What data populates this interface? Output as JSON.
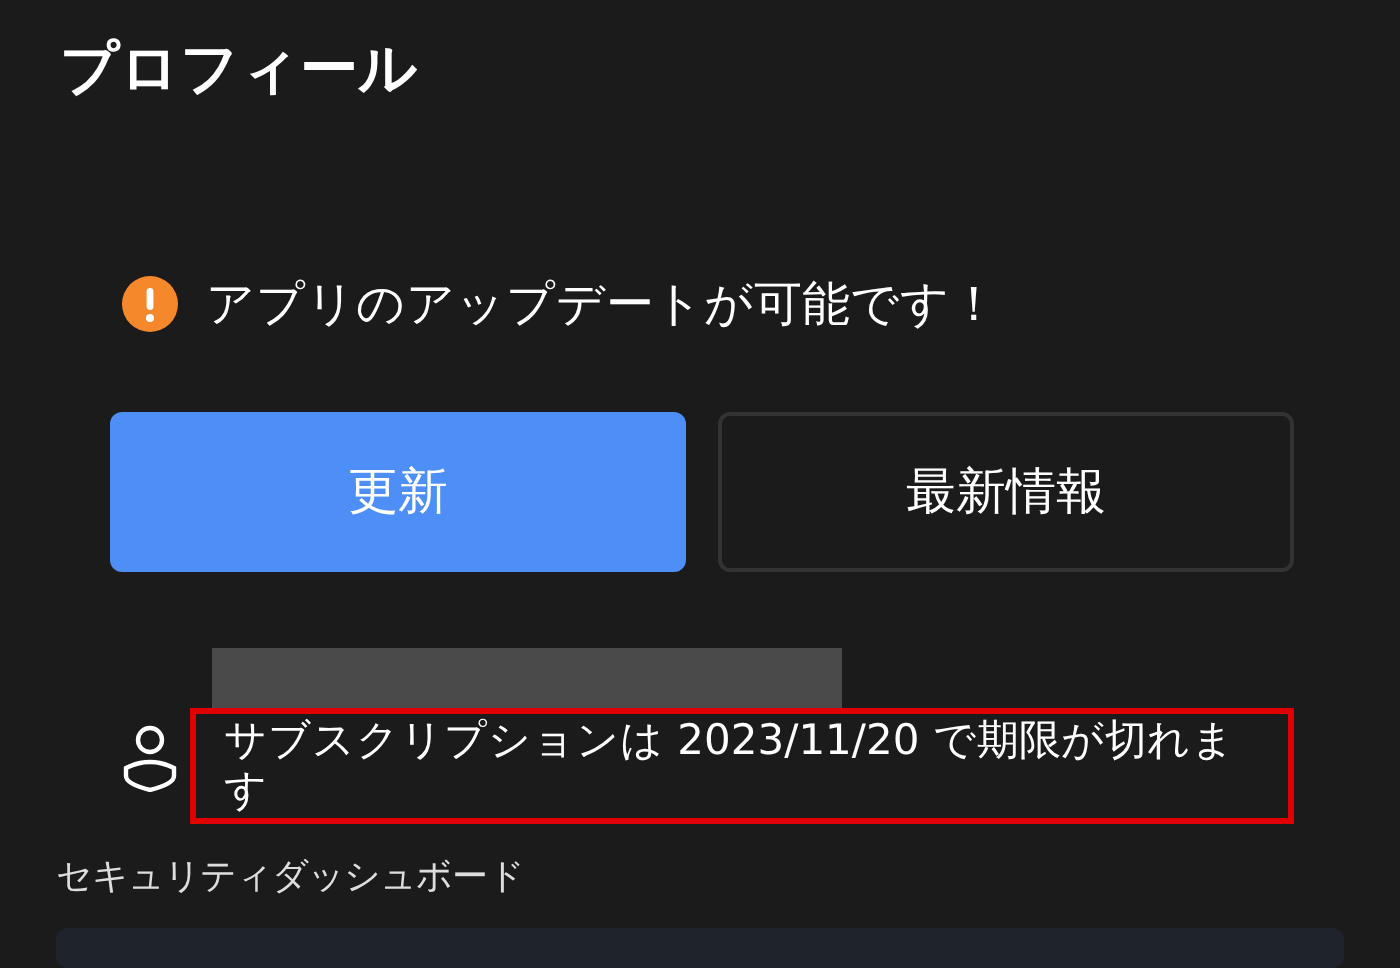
{
  "title": "プロフィール",
  "update_notice": {
    "kind": "warning",
    "text": "アプリのアップデートが可能です！"
  },
  "buttons": [
    {
      "label": "更新",
      "kind": "primary"
    },
    {
      "label": "最新情報",
      "kind": "outline"
    }
  ],
  "account": {
    "subscription": "サブスクリプションは 2023/11/20 で期限が切れます",
    "highlighted": true
  },
  "section": {
    "title": "セキュリティダッシュボード"
  }
}
